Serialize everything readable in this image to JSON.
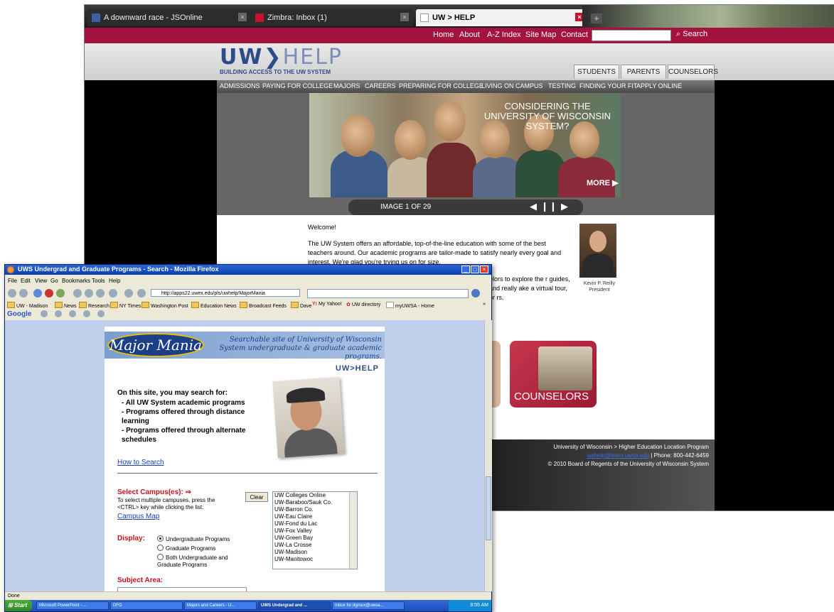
{
  "back_window": {
    "tabs": [
      {
        "title": "A downward race - JSOnline",
        "icon": "js-icon"
      },
      {
        "title": "Zimbra: Inbox (1)",
        "icon": "zimbra-icon"
      },
      {
        "title": "UW > HELP",
        "icon": "page-icon"
      }
    ],
    "top_nav": {
      "links": [
        "Home",
        "About",
        "A-Z Index",
        "Site Map",
        "Contact"
      ],
      "search_label": "Search",
      "search_icon": "search-icon"
    },
    "logo": {
      "uw": "UW",
      "help": "HELP",
      "tagline": "BUILDING ACCESS TO THE UW SYSTEM"
    },
    "audience_tabs": [
      "STUDENTS",
      "PARENTS",
      "COUNSELORS"
    ],
    "menu": [
      "ADMISSIONS",
      "PAYING FOR COLLEGE",
      "MAJORS",
      "CAREERS",
      "PREPARING FOR COLLEGE",
      "LIVING ON CAMPUS",
      "TESTING",
      "FINDING YOUR FIT",
      "APPLY ONLINE"
    ],
    "hero": {
      "headline": "CONSIDERING THE UNIVERSITY OF WISCONSIN SYSTEM?",
      "more_label": "MORE",
      "counter": "IMAGE 1 OF 29",
      "controls": "◀ ❙❙ ▶"
    },
    "welcome": {
      "heading": "Welcome!",
      "paragraph1": "The UW System offers an affordable, top-of-the-line education with some of the best teachers around. Our academic programs are tailor-made to satisfy nearly every goal and interest. We're glad you're trying us on for size.",
      "paragraph2": "elors to explore the r guides, and really ake a virtual tour, or rs."
    },
    "president": {
      "name": "Kevin P. Reilly",
      "title": "President"
    },
    "counselors_card": "COUNSELORS",
    "footer": {
      "line1": "University of Wisconsin > Higher Education Location Program",
      "email": "uwhelp@learn.uwsa.edu",
      "phone": " | Phone: 800-442-6459",
      "copyright": "© 2010 Board of Regents of the University of Wisconsin System"
    }
  },
  "front_window": {
    "title": "UWS Undergrad and Graduate Programs - Search - Mozilla Firefox",
    "menu": [
      "File",
      "Edit",
      "View",
      "Go",
      "Bookmarks",
      "Tools",
      "Help"
    ],
    "url": "http://apps22.uwex.edu/pls/uwhelp/MajorMania",
    "bookmarks": [
      "UW - Madison",
      "News",
      "Research",
      "NY Times",
      "Washington Post",
      "Education News",
      "Broadcast Feeds",
      "Dave",
      "My Yahoo!",
      "UW directory",
      "myUWSA - Home"
    ],
    "google_label": "Google",
    "page": {
      "logo_text": "Major Mania",
      "tagline": "Searchable site of University of Wisconsin System undergraduate & graduate academic programs.",
      "uwhelp": "UW>HELP",
      "search_for": "On this site, you may search for:",
      "bullets": [
        "All UW System academic programs",
        "Programs offered through distance learning",
        "Programs offered through alternate schedules"
      ],
      "how_to_search": "How to Search",
      "select_campus_label": "Select Campus(es):",
      "select_help": "To select multiple campuses, press the <CTRL> key while clicking the list:",
      "campus_map": "Campus Map",
      "clear_label": "Clear",
      "campuses": [
        "UW Colleges Online",
        "UW-Baraboo/Sauk Co.",
        "UW-Barron Co.",
        "UW-Eau Claire",
        "UW-Fond du Lac",
        "UW-Fox Valley",
        "UW-Green Bay",
        "UW-La Crosse",
        "UW-Madison",
        "UW-Manitowoc"
      ],
      "display_label": "Display:",
      "display_options": [
        "Undergraduate Programs",
        "Graduate Programs",
        "Both Undergraduate and Graduate Programs"
      ],
      "display_selected": "Undergraduate Programs",
      "subject_area_label": "Subject Area:"
    },
    "status": "Done",
    "taskbar": {
      "start": "Start",
      "items": [
        "Microsoft PowerPoint - ...",
        "DFG",
        "Majors and Careers - U...",
        "UWS Undergrad and ...",
        "Inbox for dgroux@uwsa..."
      ],
      "clock": "8:55 AM"
    }
  }
}
